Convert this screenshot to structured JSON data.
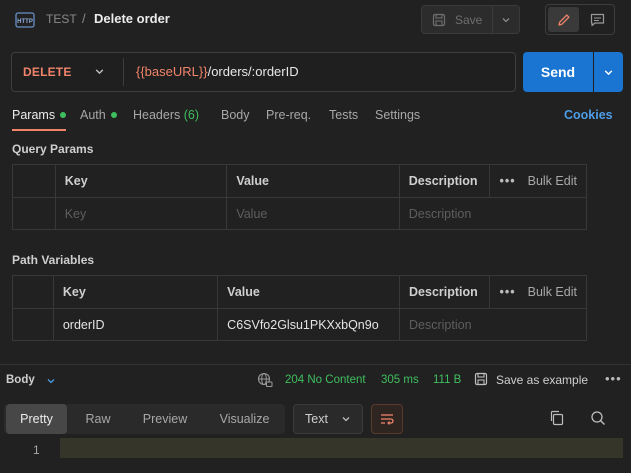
{
  "header": {
    "http_icon": "http-icon",
    "collection": "TEST",
    "separator": "/",
    "request_name": "Delete order",
    "save_label": "Save"
  },
  "request": {
    "method": "DELETE",
    "url_variable": "{{baseURL}}",
    "url_path": "/orders/:orderID",
    "send_label": "Send"
  },
  "tabs": [
    {
      "label": "Params",
      "active": true,
      "dot": true
    },
    {
      "label": "Auth",
      "dot": true
    },
    {
      "label": "Headers",
      "count": "(6)"
    },
    {
      "label": "Body"
    },
    {
      "label": "Pre-req."
    },
    {
      "label": "Tests"
    },
    {
      "label": "Settings"
    }
  ],
  "cookies_label": "Cookies",
  "query_params": {
    "title": "Query Params",
    "columns": [
      "Key",
      "Value",
      "Description"
    ],
    "bulk_edit": "Bulk Edit",
    "more": "•••",
    "placeholder": {
      "key": "Key",
      "value": "Value",
      "description": "Description"
    }
  },
  "path_variables": {
    "title": "Path Variables",
    "columns": [
      "Key",
      "Value",
      "Description"
    ],
    "bulk_edit": "Bulk Edit",
    "more": "•••",
    "rows": [
      {
        "key": "orderID",
        "value": "C6SVfo2Glsu1PKXxbQn9o",
        "description_placeholder": "Description"
      }
    ]
  },
  "response": {
    "body_label": "Body",
    "status": "204 No Content",
    "time": "305 ms",
    "size": "111 B",
    "save_example": "Save as example",
    "more": "•••",
    "view_tabs": [
      "Pretty",
      "Raw",
      "Preview",
      "Visualize"
    ],
    "format": "Text",
    "line_number": "1"
  },
  "colors": {
    "accent": "#f0846a",
    "send": "#1a75d2",
    "success": "#3fbf5f",
    "link": "#4d9de6"
  }
}
